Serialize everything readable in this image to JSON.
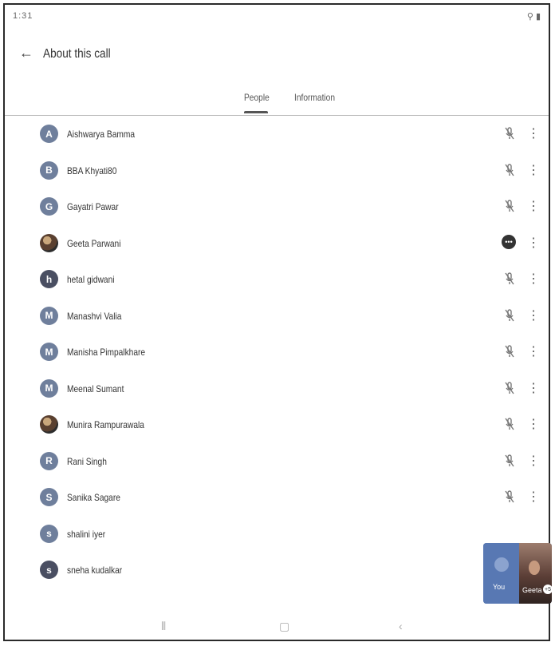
{
  "status": {
    "time": "1:31",
    "right": "⚲ ▮"
  },
  "appbar": {
    "title": "About this call"
  },
  "tabs": [
    {
      "label": "People"
    },
    {
      "label": "Information"
    }
  ],
  "participants": [
    {
      "name": "Aishwarya Bamma",
      "initial": "A",
      "avatar": "letter",
      "mic": "muted"
    },
    {
      "name": "BBA Khyati80",
      "initial": "B",
      "avatar": "letter",
      "mic": "muted"
    },
    {
      "name": "Gayatri Pawar",
      "initial": "G",
      "avatar": "letter",
      "mic": "muted"
    },
    {
      "name": "Geeta Parwani",
      "initial": "",
      "avatar": "photo",
      "mic": "speaking"
    },
    {
      "name": "hetal gidwani",
      "initial": "h",
      "avatar": "dark",
      "mic": "muted"
    },
    {
      "name": "Manashvi Valia",
      "initial": "M",
      "avatar": "letter",
      "mic": "muted"
    },
    {
      "name": "Manisha Pimpalkhare",
      "initial": "M",
      "avatar": "letter",
      "mic": "muted"
    },
    {
      "name": "Meenal Sumant",
      "initial": "M",
      "avatar": "letter",
      "mic": "muted"
    },
    {
      "name": "Munira Rampurawala",
      "initial": "",
      "avatar": "photo",
      "mic": "muted"
    },
    {
      "name": "Rani Singh",
      "initial": "R",
      "avatar": "letter",
      "mic": "muted"
    },
    {
      "name": "Sanika Sagare",
      "initial": "S",
      "avatar": "letter",
      "mic": "muted"
    },
    {
      "name": "shalini iyer",
      "initial": "s",
      "avatar": "letter",
      "mic": "none"
    },
    {
      "name": "sneha kudalkar",
      "initial": "s",
      "avatar": "dark",
      "mic": "none"
    }
  ],
  "pip": {
    "you_label": "You",
    "other_label": "Geeta",
    "badge": "+5"
  },
  "navbar": {
    "recent": "⦀",
    "home": "▢",
    "back": "‹"
  }
}
